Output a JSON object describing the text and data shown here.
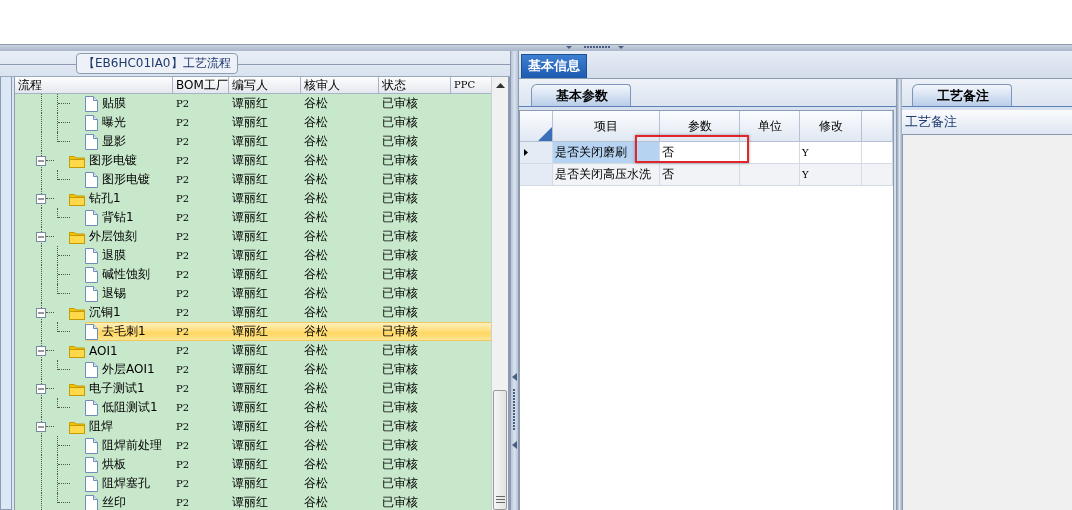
{
  "left_panel": {
    "title": "【EB6HC01IA0】工艺流程",
    "columns": [
      "流程",
      "BOM工厂",
      "编写人",
      "核审人",
      "状态",
      "PPC"
    ],
    "hidden_parent_children": [
      {
        "label": "贴膜",
        "bom": "P2",
        "author": "谭丽红",
        "reviewer": "谷松",
        "status": "已审核",
        "selected": false
      },
      {
        "label": "曝光",
        "bom": "P2",
        "author": "谭丽红",
        "reviewer": "谷松",
        "status": "已审核",
        "selected": false
      },
      {
        "label": "显影",
        "bom": "P2",
        "author": "谭丽红",
        "reviewer": "谷松",
        "status": "已审核",
        "selected": false
      }
    ],
    "nodes": [
      {
        "label": "图形电镀",
        "bom": "P2",
        "author": "谭丽红",
        "reviewer": "谷松",
        "status": "已审核",
        "selected": false,
        "expanded": true,
        "children": [
          {
            "label": "图形电镀",
            "bom": "P2",
            "author": "谭丽红",
            "reviewer": "谷松",
            "status": "已审核",
            "selected": false
          }
        ]
      },
      {
        "label": "钻孔1",
        "bom": "P2",
        "author": "谭丽红",
        "reviewer": "谷松",
        "status": "已审核",
        "selected": false,
        "expanded": true,
        "children": [
          {
            "label": "背钻1",
            "bom": "P2",
            "author": "谭丽红",
            "reviewer": "谷松",
            "status": "已审核",
            "selected": false
          }
        ]
      },
      {
        "label": "外层蚀刻",
        "bom": "P2",
        "author": "谭丽红",
        "reviewer": "谷松",
        "status": "已审核",
        "selected": false,
        "expanded": true,
        "children": [
          {
            "label": "退膜",
            "bom": "P2",
            "author": "谭丽红",
            "reviewer": "谷松",
            "status": "已审核",
            "selected": false
          },
          {
            "label": "碱性蚀刻",
            "bom": "P2",
            "author": "谭丽红",
            "reviewer": "谷松",
            "status": "已审核",
            "selected": false
          },
          {
            "label": "退锡",
            "bom": "P2",
            "author": "谭丽红",
            "reviewer": "谷松",
            "status": "已审核",
            "selected": false
          }
        ]
      },
      {
        "label": "沉铜1",
        "bom": "P2",
        "author": "谭丽红",
        "reviewer": "谷松",
        "status": "已审核",
        "selected": false,
        "expanded": true,
        "children": [
          {
            "label": "去毛刺1",
            "bom": "P2",
            "author": "谭丽红",
            "reviewer": "谷松",
            "status": "已审核",
            "selected": true
          }
        ]
      },
      {
        "label": "AOI1",
        "bom": "P2",
        "author": "谭丽红",
        "reviewer": "谷松",
        "status": "已审核",
        "selected": false,
        "expanded": true,
        "children": [
          {
            "label": "外层AOI1",
            "bom": "P2",
            "author": "谭丽红",
            "reviewer": "谷松",
            "status": "已审核",
            "selected": false
          }
        ]
      },
      {
        "label": "电子测试1",
        "bom": "P2",
        "author": "谭丽红",
        "reviewer": "谷松",
        "status": "已审核",
        "selected": false,
        "expanded": true,
        "children": [
          {
            "label": "低阻测试1",
            "bom": "P2",
            "author": "谭丽红",
            "reviewer": "谷松",
            "status": "已审核",
            "selected": false
          }
        ]
      },
      {
        "label": "阻焊",
        "bom": "P2",
        "author": "谭丽红",
        "reviewer": "谷松",
        "status": "已审核",
        "selected": false,
        "expanded": true,
        "children": [
          {
            "label": "阻焊前处理",
            "bom": "P2",
            "author": "谭丽红",
            "reviewer": "谷松",
            "status": "已审核",
            "selected": false
          },
          {
            "label": "烘板",
            "bom": "P2",
            "author": "谭丽红",
            "reviewer": "谷松",
            "status": "已审核",
            "selected": false
          },
          {
            "label": "阻焊塞孔",
            "bom": "P2",
            "author": "谭丽红",
            "reviewer": "谷松",
            "status": "已审核",
            "selected": false
          },
          {
            "label": "丝印",
            "bom": "P2",
            "author": "谭丽红",
            "reviewer": "谷松",
            "status": "已审核",
            "selected": false
          }
        ]
      }
    ]
  },
  "right_panel": {
    "tabs": [
      {
        "label": "基本信息",
        "selected": true
      }
    ],
    "params": {
      "tabs": [
        {
          "label": "基本参数",
          "selected": true
        }
      ],
      "columns": [
        "项目",
        "参数",
        "单位",
        "修改"
      ],
      "rows": [
        {
          "item": "是否关闭磨刷",
          "value": "否",
          "modified": "Y",
          "selected": true,
          "annotated": true
        },
        {
          "item": "是否关闭高压水洗",
          "value": "否",
          "modified": "Y",
          "selected": false,
          "annotated": false
        }
      ]
    },
    "notes": {
      "tabs": [
        {
          "label": "工艺备注",
          "selected": true
        }
      ],
      "header": "工艺备注"
    }
  }
}
